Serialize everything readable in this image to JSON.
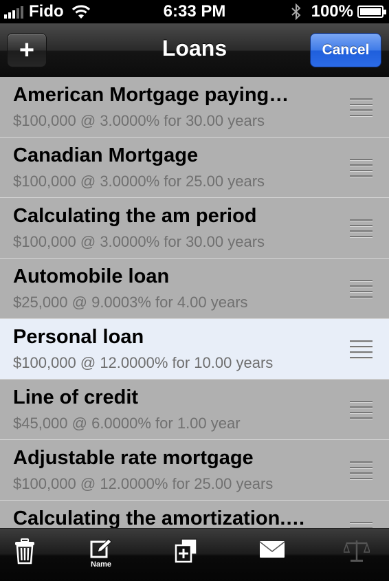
{
  "status": {
    "carrier": "Fido",
    "time": "6:33 PM",
    "battery": "100%"
  },
  "nav": {
    "add_label": "+",
    "title": "Loans",
    "cancel_label": "Cancel"
  },
  "loans": [
    {
      "title": "American Mortgage  paying…",
      "detail": "$100,000 @ 3.0000% for 30.00 years",
      "selected": false
    },
    {
      "title": "Canadian Mortgage",
      "detail": "$100,000 @ 3.0000% for 25.00 years",
      "selected": false
    },
    {
      "title": "Calculating the am period",
      "detail": "$100,000 @ 3.0000% for 30.00 years",
      "selected": false
    },
    {
      "title": "Automobile loan",
      "detail": "$25,000 @ 9.0003% for 4.00 years",
      "selected": false
    },
    {
      "title": "Personal loan",
      "detail": "$100,000 @ 12.0000% for 10.00 years",
      "selected": true
    },
    {
      "title": "Line of credit",
      "detail": "$45,000 @ 6.0000% for 1.00 year",
      "selected": false
    },
    {
      "title": "Adjustable rate mortgage",
      "detail": "$100,000 @ 12.0000% for 25.00 years",
      "selected": false
    },
    {
      "title": "Calculating the amortization.…",
      "detail": "",
      "selected": false
    }
  ],
  "toolbar": {
    "trash_icon": "trash-icon",
    "name_label": "Name",
    "duplicate_icon": "duplicate-icon",
    "mail_icon": "mail-icon",
    "compare_icon": "scales-icon"
  }
}
